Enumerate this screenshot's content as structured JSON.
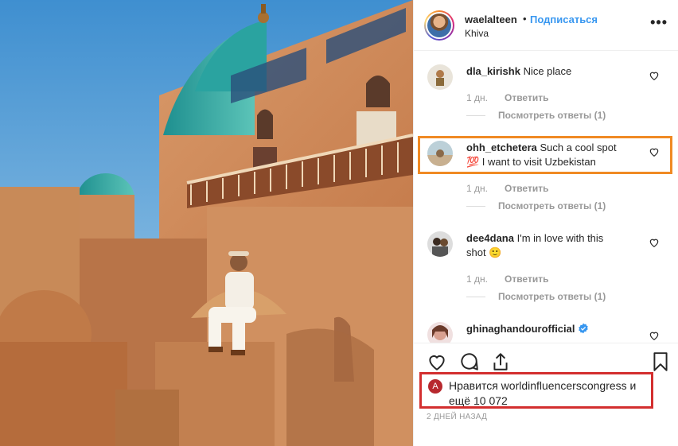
{
  "header": {
    "username": "waelalteen",
    "separator": "•",
    "follow_label": "Подписаться",
    "location": "Khiva",
    "more_label": "•••"
  },
  "comments": [
    {
      "user": "dla_kirishk",
      "text": "Nice place",
      "age": "1 дн.",
      "reply_label": "Ответить",
      "view_replies": "Посмотреть ответы (1)"
    },
    {
      "user": "ohh_etchetera",
      "text": "Such a cool spot",
      "text2": "💯 I want to visit Uzbekistan",
      "age": "1 дн.",
      "reply_label": "Ответить",
      "view_replies": "Посмотреть ответы (1)"
    },
    {
      "user": "dee4dana",
      "text": "I'm in love with this",
      "text2": "shot 🙂",
      "age": "1 дн.",
      "reply_label": "Ответить",
      "view_replies": "Посмотреть ответы (1)"
    },
    {
      "user": "ghinaghandourofficial",
      "text": ""
    }
  ],
  "likes": {
    "prefix": "Нравится",
    "liker": "worldinfluencerscongress",
    "middle": "и",
    "line2": "ещё 10 072",
    "avatar_letter": "A"
  },
  "post_date": "2 ДНЕЙ НАЗАД",
  "colors": {
    "link": "#3897f0",
    "highlight_comment": "#f08a24",
    "highlight_likes": "#d32f2f",
    "verified": "#3897f0"
  }
}
